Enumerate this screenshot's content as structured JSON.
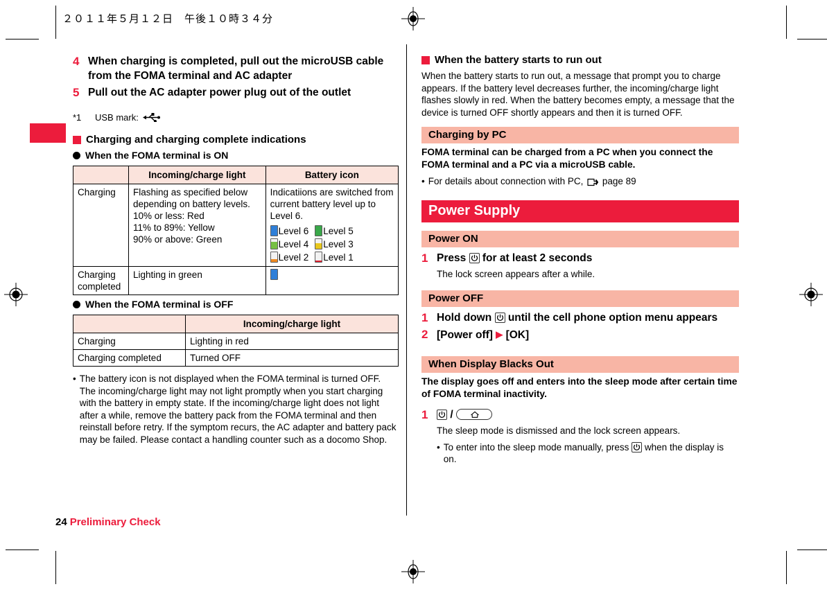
{
  "page_stamp": "２０１１年５月１２日　午後１０時３４分",
  "left_column": {
    "steps": [
      {
        "num": "4",
        "text": "When charging is completed, pull out the microUSB cable from the FOMA terminal and AC adapter"
      },
      {
        "num": "5",
        "text": "Pull out the AC adapter power plug out of the outlet"
      }
    ],
    "footnote": {
      "mark": "*1",
      "label": "USB mark:"
    },
    "heading_square": "Charging and charging complete indications",
    "heading_circle_on": "When the FOMA terminal is ON",
    "table_on": {
      "headers": [
        "",
        "Incoming/charge light",
        "Battery icon"
      ],
      "rows": [
        {
          "label": "Charging",
          "light": "Flashing as specified below depending on battery levels.\n10% or less: Red\n11% to 89%: Yellow\n90% or above: Green",
          "icon_text": "Indicatiions are switched from current battery level up to Level 6.",
          "levels": [
            {
              "label": "Level 6",
              "color": "#2f7fd8",
              "fill": 100
            },
            {
              "label": "Level 5",
              "color": "#3aa84a",
              "fill": 100
            },
            {
              "label": "Level 4",
              "color": "#76c043",
              "fill": 72
            },
            {
              "label": "Level 3",
              "color": "#e8c71d",
              "fill": 55
            },
            {
              "label": "Level 2",
              "color": "#ef8a22",
              "fill": 32
            },
            {
              "label": "Level 1",
              "color": "#e0202f",
              "fill": 14
            }
          ]
        },
        {
          "label": "Charging completed",
          "light": "Lighting in green",
          "icon_text": "",
          "levels": [
            {
              "label": "",
              "color": "#2f7fd8",
              "fill": 100
            }
          ]
        }
      ]
    },
    "heading_circle_off": "When the FOMA terminal is OFF",
    "table_off": {
      "headers": [
        "",
        "Incoming/charge light"
      ],
      "rows": [
        {
          "label": "Charging",
          "value": "Lighting in red"
        },
        {
          "label": "Charging completed",
          "value": "Turned OFF"
        }
      ]
    },
    "note": "The battery icon is not displayed when the FOMA terminal is turned OFF. The incoming/charge light may not light promptly when you start charging with the battery in empty state. If the incoming/charge light does not light after a while, remove the battery pack from the FOMA terminal and then reinstall before retry. If the symptom recurs, the AC adapter and battery pack may be failed. Please contact a handling counter such as a docomo Shop.",
    "note_bullet": "•"
  },
  "right_column": {
    "heading_square": "When the battery starts to run out",
    "paragraph": "When the battery starts to run out, a message that prompt you to charge appears. If the battery level decreases further, the incoming/charge light flashes slowly in red. When the battery becomes empty, a message that the device is turned OFF shortly appears and then it is turned OFF.",
    "charging_by_pc": {
      "band": "Charging by PC",
      "body": "FOMA terminal can be charged from a PC when you connect the FOMA terminal and a PC via a microUSB cable.",
      "bullet": "•",
      "bullet_text_before": "For details about connection with PC,",
      "bullet_text_after": "page 89"
    },
    "power_supply": {
      "band": "Power Supply",
      "power_on": {
        "band": "Power ON",
        "step_num": "1",
        "step_before": "Press",
        "step_after": "for at least 2 seconds",
        "sub": "The lock screen appears after a while."
      },
      "power_off": {
        "band": "Power OFF",
        "steps": [
          {
            "num": "1",
            "before": "Hold down",
            "after": "until the cell phone option menu appears"
          },
          {
            "num": "2",
            "text_a": "[Power off]",
            "arrow": "▶",
            "text_b": "[OK]"
          }
        ]
      }
    },
    "display_blacks_out": {
      "band": "When Display Blacks Out",
      "body": "The display goes off and enters into the sleep mode after certain time of FOMA terminal inactivity.",
      "step_num": "1",
      "separator": "/",
      "sub": "The sleep mode is dismissed and the lock screen appears.",
      "bullet": "•",
      "bullet_before": "To enter into the sleep mode manually, press",
      "bullet_after": "when the display is on."
    }
  },
  "footer": {
    "page_number": "24",
    "section": "Preliminary Check"
  },
  "colors": {
    "accent_red": "#ec1c3c",
    "band_pink": "#f8b5a5",
    "table_header_pink": "#fbe3dc"
  }
}
